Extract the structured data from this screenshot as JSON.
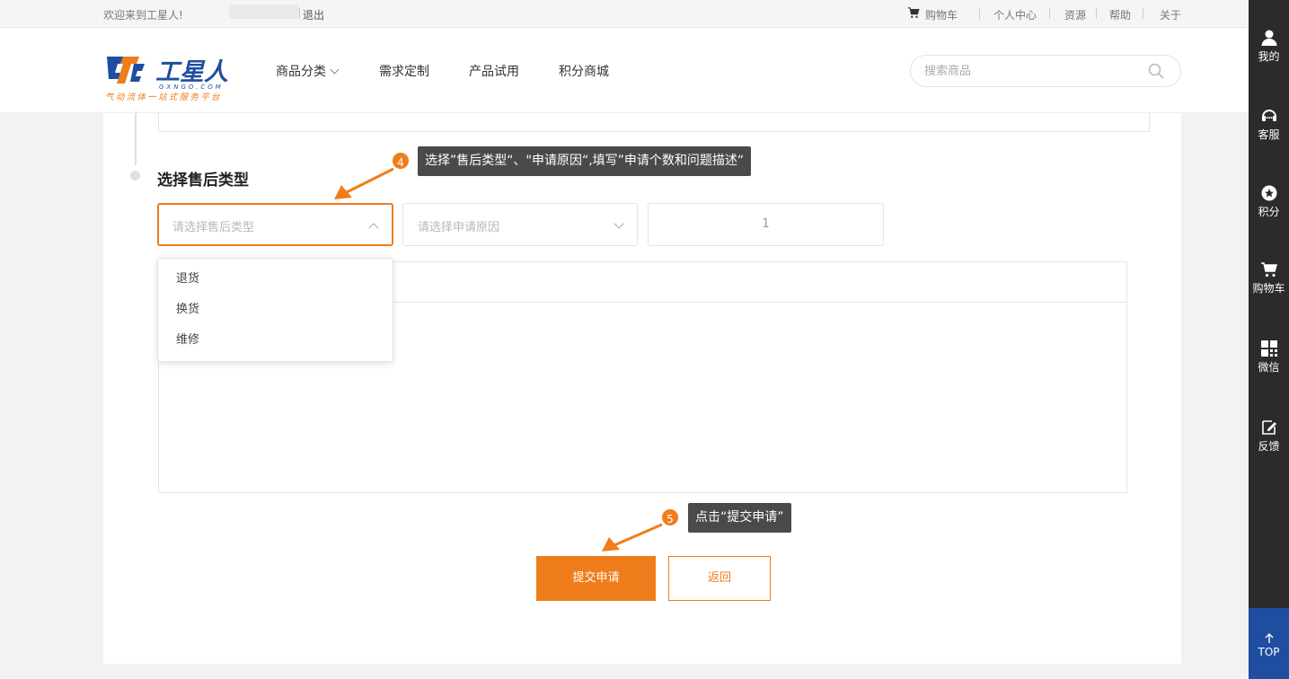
{
  "topbar": {
    "welcome": "欢迎来到工星人!",
    "logout": "退出",
    "cart": "购物车",
    "user_center": "个人中心",
    "resources": "资源",
    "help": "帮助",
    "about": "关于"
  },
  "header": {
    "logo_text": "工星人",
    "logo_domain": "GXNGO.COM",
    "logo_slogan": "气动流体一站式服务平台",
    "nav": [
      "商品分类",
      "需求定制",
      "产品试用",
      "积分商城"
    ],
    "search_placeholder": "搜索商品"
  },
  "form": {
    "section_title": "选择售后类型",
    "type_placeholder": "请选择售后类型",
    "reason_placeholder": "请选择申请原因",
    "quantity": "1",
    "type_options": [
      "退货",
      "换货",
      "维修"
    ],
    "submit_label": "提交申请",
    "back_label": "返回"
  },
  "callouts": [
    {
      "step": "4",
      "text": "选择”售后类型“、\"申请原因“,填写”申请个数和问题描述“"
    },
    {
      "step": "5",
      "text": "点击“提交申请”"
    }
  ],
  "sidebar": {
    "items": [
      "我的",
      "客服",
      "积分",
      "购物车",
      "微信",
      "反馈"
    ],
    "top": "TOP"
  },
  "colors": {
    "accent": "#ef7d1b",
    "logo_blue": "#1f4ea0",
    "sidebar_bg": "#2b2b2b",
    "tooltip_bg": "#4a4a4a"
  }
}
